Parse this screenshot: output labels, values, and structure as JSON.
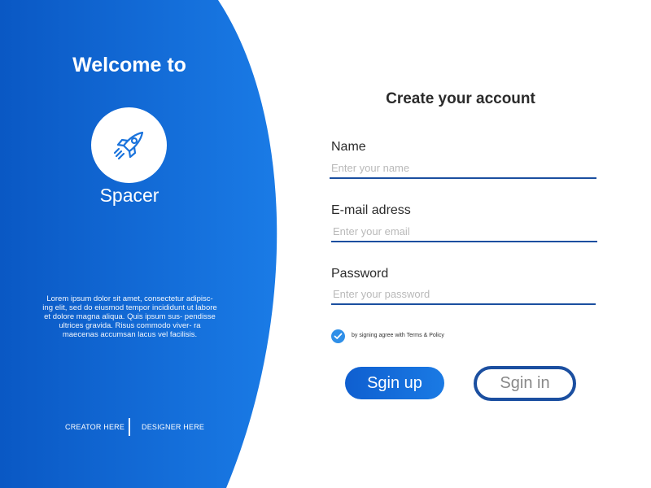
{
  "brand": {
    "welcome": "Welcome to",
    "logo_icon": "rocket-icon",
    "app_name": "Spacer",
    "description": "Lorem ipsum dolor sit amet, consectetur adipisc- ing elit, sed do eiusmod tempor incididunt ut labore et dolore magna aliqua. Quis ipsum sus- pendisse ultrices gravida. Risus commodo viver- ra maecenas accumsan lacus vel facilisis.",
    "creator": "CREATOR HERE",
    "designer": "DESIGNER HERE"
  },
  "form": {
    "title": "Create your account",
    "name": {
      "label": "Name",
      "placeholder": "Enter your name",
      "value": ""
    },
    "email": {
      "label": "E-mail adress",
      "placeholder": "Enter your email",
      "value": ""
    },
    "password": {
      "label": "Password",
      "placeholder": "Enter your password",
      "value": ""
    },
    "terms": {
      "checked": true,
      "label": "by signing agree with Terms & Policy"
    },
    "signup_label": "Sgin up",
    "signin_label": "Sgin in"
  },
  "colors": {
    "panel_blue_dark": "#0a58c4",
    "panel_blue_light": "#1a7be6",
    "input_underline": "#1b4fa0",
    "check_blue": "#2f8fe8"
  }
}
